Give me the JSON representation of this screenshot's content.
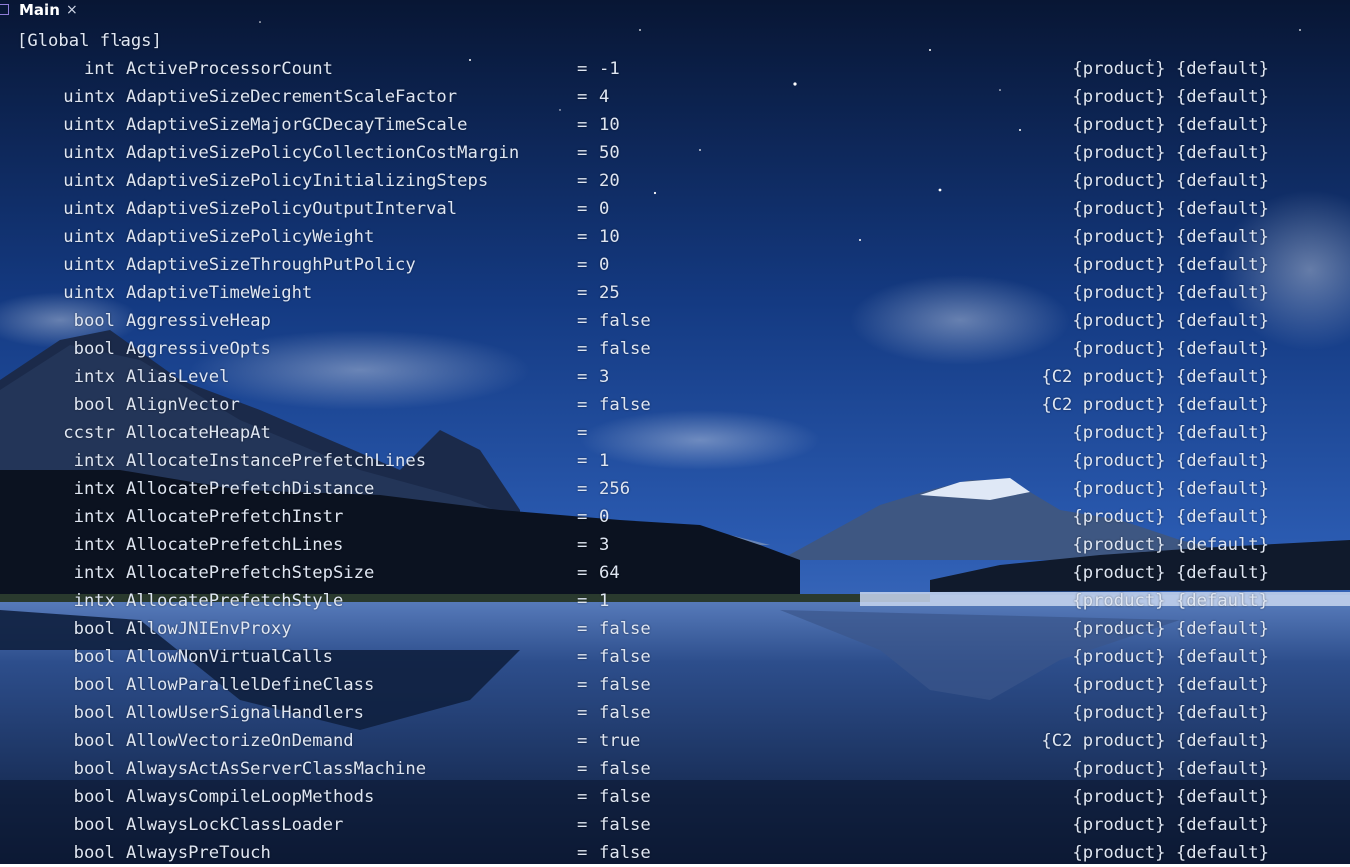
{
  "tab": {
    "label": "Main",
    "close_glyph": "×",
    "icon": "terminal-tab-icon"
  },
  "header": "[Global flags]",
  "rows": [
    {
      "type": "int",
      "name": "ActiveProcessorCount",
      "value": "-1",
      "attrs": "{product} {default}"
    },
    {
      "type": "uintx",
      "name": "AdaptiveSizeDecrementScaleFactor",
      "value": "4",
      "attrs": "{product} {default}"
    },
    {
      "type": "uintx",
      "name": "AdaptiveSizeMajorGCDecayTimeScale",
      "value": "10",
      "attrs": "{product} {default}"
    },
    {
      "type": "uintx",
      "name": "AdaptiveSizePolicyCollectionCostMargin",
      "value": "50",
      "attrs": "{product} {default}"
    },
    {
      "type": "uintx",
      "name": "AdaptiveSizePolicyInitializingSteps",
      "value": "20",
      "attrs": "{product} {default}"
    },
    {
      "type": "uintx",
      "name": "AdaptiveSizePolicyOutputInterval",
      "value": "0",
      "attrs": "{product} {default}"
    },
    {
      "type": "uintx",
      "name": "AdaptiveSizePolicyWeight",
      "value": "10",
      "attrs": "{product} {default}"
    },
    {
      "type": "uintx",
      "name": "AdaptiveSizeThroughPutPolicy",
      "value": "0",
      "attrs": "{product} {default}"
    },
    {
      "type": "uintx",
      "name": "AdaptiveTimeWeight",
      "value": "25",
      "attrs": "{product} {default}"
    },
    {
      "type": "bool",
      "name": "AggressiveHeap",
      "value": "false",
      "attrs": "{product} {default}"
    },
    {
      "type": "bool",
      "name": "AggressiveOpts",
      "value": "false",
      "attrs": "{product} {default}"
    },
    {
      "type": "intx",
      "name": "AliasLevel",
      "value": "3",
      "attrs": "{C2 product} {default}"
    },
    {
      "type": "bool",
      "name": "AlignVector",
      "value": "false",
      "attrs": "{C2 product} {default}"
    },
    {
      "type": "ccstr",
      "name": "AllocateHeapAt",
      "value": "",
      "attrs": "{product} {default}"
    },
    {
      "type": "intx",
      "name": "AllocateInstancePrefetchLines",
      "value": "1",
      "attrs": "{product} {default}"
    },
    {
      "type": "intx",
      "name": "AllocatePrefetchDistance",
      "value": "256",
      "attrs": "{product} {default}"
    },
    {
      "type": "intx",
      "name": "AllocatePrefetchInstr",
      "value": "0",
      "attrs": "{product} {default}"
    },
    {
      "type": "intx",
      "name": "AllocatePrefetchLines",
      "value": "3",
      "attrs": "{product} {default}"
    },
    {
      "type": "intx",
      "name": "AllocatePrefetchStepSize",
      "value": "64",
      "attrs": "{product} {default}"
    },
    {
      "type": "intx",
      "name": "AllocatePrefetchStyle",
      "value": "1",
      "attrs": "{product} {default}"
    },
    {
      "type": "bool",
      "name": "AllowJNIEnvProxy",
      "value": "false",
      "attrs": "{product} {default}"
    },
    {
      "type": "bool",
      "name": "AllowNonVirtualCalls",
      "value": "false",
      "attrs": "{product} {default}"
    },
    {
      "type": "bool",
      "name": "AllowParallelDefineClass",
      "value": "false",
      "attrs": "{product} {default}"
    },
    {
      "type": "bool",
      "name": "AllowUserSignalHandlers",
      "value": "false",
      "attrs": "{product} {default}"
    },
    {
      "type": "bool",
      "name": "AllowVectorizeOnDemand",
      "value": "true",
      "attrs": "{C2 product} {default}"
    },
    {
      "type": "bool",
      "name": "AlwaysActAsServerClassMachine",
      "value": "false",
      "attrs": "{product} {default}"
    },
    {
      "type": "bool",
      "name": "AlwaysCompileLoopMethods",
      "value": "false",
      "attrs": "{product} {default}"
    },
    {
      "type": "bool",
      "name": "AlwaysLockClassLoader",
      "value": "false",
      "attrs": "{product} {default}"
    },
    {
      "type": "bool",
      "name": "AlwaysPreTouch",
      "value": "false",
      "attrs": "{product} {default}"
    }
  ],
  "colors": {
    "text": "#dfe6f2",
    "sky_top": "#0b1a3c",
    "sky_mid": "#1f4aa0",
    "lake": "#2c4f86"
  }
}
